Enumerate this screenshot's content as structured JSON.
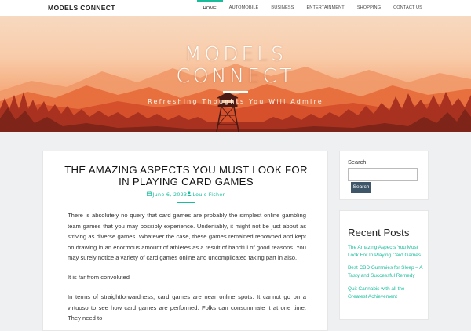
{
  "header": {
    "brand": "MODELS CONNECT",
    "nav": [
      {
        "label": "HOME",
        "active": true
      },
      {
        "label": "AUTOMOBILE",
        "active": false
      },
      {
        "label": "BUSINESS",
        "active": false
      },
      {
        "label": "ENTERTAINMENT",
        "active": false
      },
      {
        "label": "SHOPPING",
        "active": false
      },
      {
        "label": "CONTACT US",
        "active": false
      }
    ]
  },
  "hero": {
    "title_line1": "MODELS",
    "title_line2": "CONNECT",
    "tagline": "Refreshing Thoughts You Will Admire"
  },
  "article": {
    "title": "THE AMAZING ASPECTS YOU MUST LOOK FOR IN PLAYING CARD GAMES",
    "date": "June 6, 2023",
    "author": "Louis Fisher",
    "date_icon": "calendar-icon",
    "author_icon": "user-icon",
    "paragraphs": [
      "There is absolutely no query that card games are probably the simplest online gambling team games that you may possibly experience. Undeniably, it might not be just about as striving as diverse games. Whatever the case, these games remained renowned and kept on drawing in an enormous amount of athletes as a result of handful of good reasons. You may surely notice a variety of card games online and uncomplicated taking part in also.",
      "It is far from convoluted",
      "In terms of straightforwardness, card games are near online spots. It cannot go on a virtuoso to see how card games are performed. Folks can consummate it at one time. They need to"
    ]
  },
  "sidebar": {
    "search": {
      "label": "Search",
      "placeholder": "",
      "value": "",
      "button": "Search"
    },
    "recent": {
      "title": "Recent Posts",
      "items": [
        "The Amazing Aspects You Must Look For In Playing Card Games",
        "Best CBD Gummies for Sleep – A Tasty and Successful Remedy",
        "Quit Cannabis with all the Greatest Achievement"
      ]
    }
  },
  "colors": {
    "accent": "#1abc9c",
    "button": "#3f5668",
    "page_bg": "#eef0f2"
  }
}
